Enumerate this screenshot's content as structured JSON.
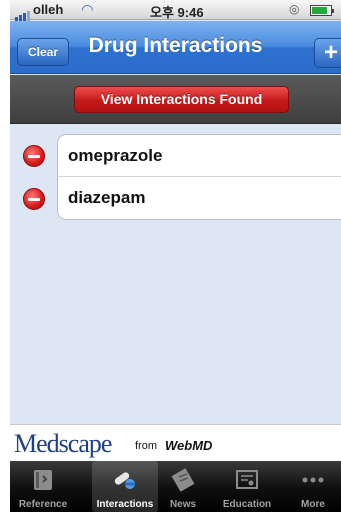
{
  "status_bar": {
    "carrier": "olleh",
    "time": "오후 9:46"
  },
  "nav": {
    "title": "Drug Interactions",
    "clear_label": "Clear",
    "add_label": "+"
  },
  "action": {
    "view_label": "View Interactions Found"
  },
  "drugs": [
    {
      "name": "omeprazole"
    },
    {
      "name": "diazepam"
    }
  ],
  "banner": {
    "brand": "Medscape",
    "from": "from",
    "partner": "WebMD"
  },
  "tabs": [
    {
      "label": "Reference",
      "icon": "book-icon"
    },
    {
      "label": "Interactions",
      "icon": "pills-icon"
    },
    {
      "label": "News",
      "icon": "newspaper-icon"
    },
    {
      "label": "Education",
      "icon": "certificate-icon"
    },
    {
      "label": "More",
      "icon": "more-dots-icon"
    }
  ],
  "active_tab": "Interactions",
  "colors": {
    "nav_blue": "#2d71cf",
    "button_red": "#c51a1a",
    "background": "#dde7f3"
  }
}
